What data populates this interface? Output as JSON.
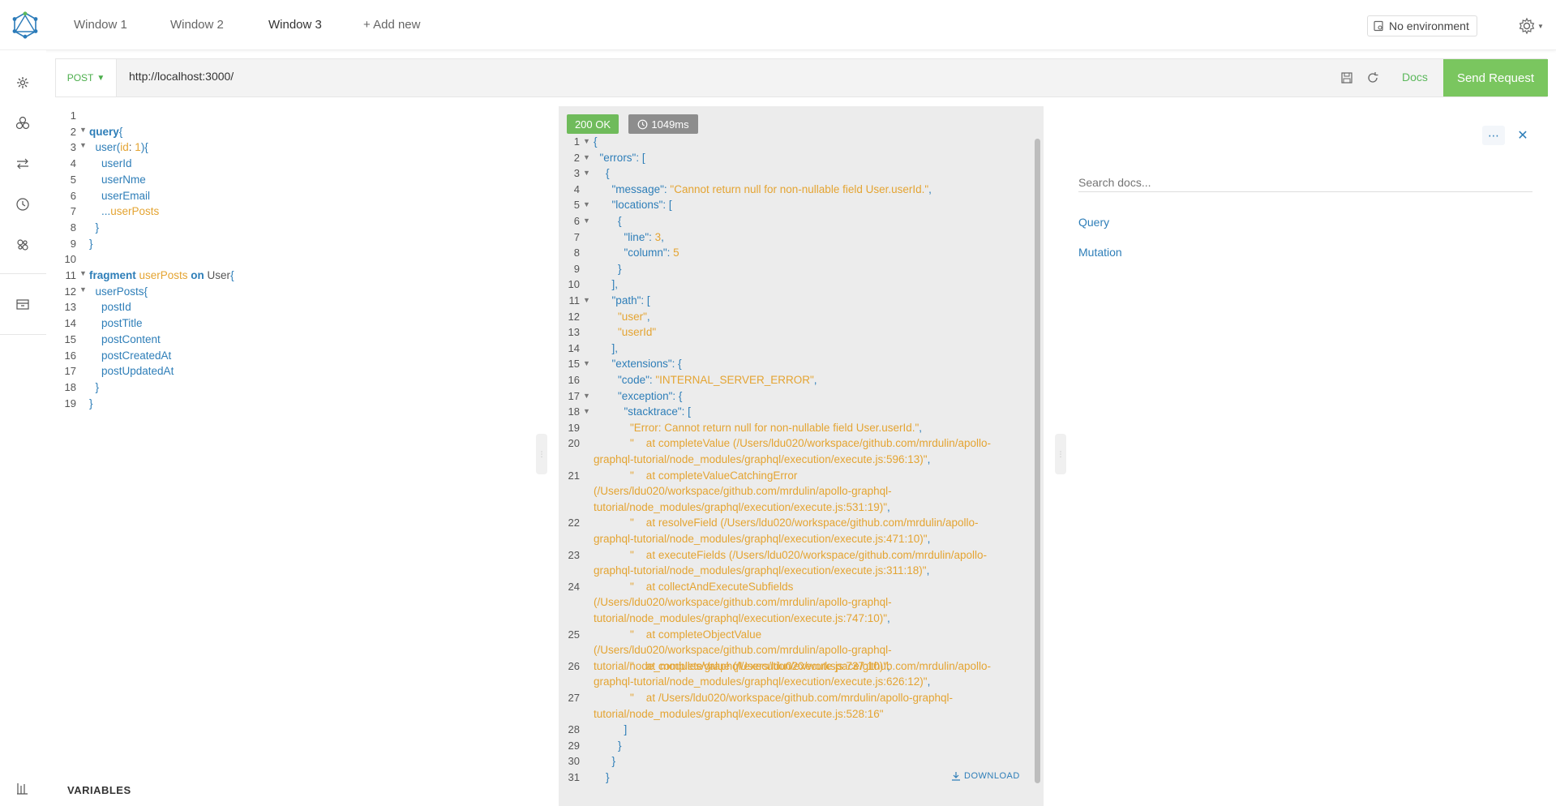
{
  "header": {
    "tabs": [
      {
        "label": "Window 1",
        "active": false
      },
      {
        "label": "Window 2",
        "active": false
      },
      {
        "label": "Window 3",
        "active": true
      }
    ],
    "add_new": "+ Add new",
    "environment": "No environment",
    "environment_icon": "environment-icon",
    "settings_icon": "gear-icon"
  },
  "sidebar": {
    "icons": [
      "gear-icon",
      "collections-icon",
      "swap-icon",
      "history-icon",
      "plugins-icon",
      "archive-icon",
      "stats-icon"
    ]
  },
  "request": {
    "method": "POST",
    "url": "http://localhost:3000/",
    "docs_label": "Docs",
    "send_label": "Send Request",
    "accent_color": "#7ac65f"
  },
  "editor": {
    "lines": [
      {
        "n": "1",
        "fold": false,
        "tokens": []
      },
      {
        "n": "2",
        "fold": true,
        "tokens": [
          {
            "t": "query",
            "c": "k-kw"
          },
          {
            "t": "{",
            "c": "k-punct"
          }
        ]
      },
      {
        "n": "3",
        "fold": true,
        "tokens": [
          {
            "t": "  user",
            "c": "k-field"
          },
          {
            "t": "(",
            "c": "k-punct"
          },
          {
            "t": "id",
            "c": "k-frag"
          },
          {
            "t": ": ",
            "c": "k-type"
          },
          {
            "t": "1",
            "c": "k-num"
          },
          {
            "t": "){",
            "c": "k-punct"
          }
        ]
      },
      {
        "n": "4",
        "fold": false,
        "tokens": [
          {
            "t": "    userId",
            "c": "k-field"
          }
        ]
      },
      {
        "n": "5",
        "fold": false,
        "tokens": [
          {
            "t": "    userNme",
            "c": "k-field"
          }
        ]
      },
      {
        "n": "6",
        "fold": false,
        "tokens": [
          {
            "t": "    userEmail",
            "c": "k-field"
          }
        ]
      },
      {
        "n": "7",
        "fold": false,
        "tokens": [
          {
            "t": "    ...",
            "c": "k-field"
          },
          {
            "t": "userPosts",
            "c": "k-frag"
          }
        ]
      },
      {
        "n": "8",
        "fold": false,
        "tokens": [
          {
            "t": "  }",
            "c": "k-punct"
          }
        ]
      },
      {
        "n": "9",
        "fold": false,
        "tokens": [
          {
            "t": "}",
            "c": "k-punct"
          }
        ]
      },
      {
        "n": "10",
        "fold": false,
        "tokens": []
      },
      {
        "n": "11",
        "fold": true,
        "tokens": [
          {
            "t": "fragment ",
            "c": "k-kw"
          },
          {
            "t": "userPosts ",
            "c": "k-frag"
          },
          {
            "t": "on ",
            "c": "k-kw"
          },
          {
            "t": "User",
            "c": "k-type"
          },
          {
            "t": "{",
            "c": "k-punct"
          }
        ]
      },
      {
        "n": "12",
        "fold": true,
        "tokens": [
          {
            "t": "  userPosts",
            "c": "k-field"
          },
          {
            "t": "{",
            "c": "k-punct"
          }
        ]
      },
      {
        "n": "13",
        "fold": false,
        "tokens": [
          {
            "t": "    postId",
            "c": "k-field"
          }
        ]
      },
      {
        "n": "14",
        "fold": false,
        "tokens": [
          {
            "t": "    postTitle",
            "c": "k-field"
          }
        ]
      },
      {
        "n": "15",
        "fold": false,
        "tokens": [
          {
            "t": "    postContent",
            "c": "k-field"
          }
        ]
      },
      {
        "n": "16",
        "fold": false,
        "tokens": [
          {
            "t": "    postCreatedAt",
            "c": "k-field"
          }
        ]
      },
      {
        "n": "17",
        "fold": false,
        "tokens": [
          {
            "t": "    postUpdatedAt",
            "c": "k-field"
          }
        ]
      },
      {
        "n": "18",
        "fold": false,
        "tokens": [
          {
            "t": "  }",
            "c": "k-punct"
          }
        ]
      },
      {
        "n": "19",
        "fold": false,
        "tokens": [
          {
            "t": "}",
            "c": "k-punct"
          }
        ]
      }
    ],
    "variables_label": "VARIABLES"
  },
  "result": {
    "status": "200 OK",
    "time": "1049ms",
    "download_label": "DOWNLOAD",
    "lines": [
      {
        "n": "1",
        "fold": true,
        "rows": 1,
        "tokens": [
          {
            "t": "{",
            "c": "s-p"
          }
        ]
      },
      {
        "n": "2",
        "fold": true,
        "rows": 1,
        "tokens": [
          {
            "t": "  \"errors\"",
            "c": "s-key"
          },
          {
            "t": ": [",
            "c": "s-p"
          }
        ]
      },
      {
        "n": "3",
        "fold": true,
        "rows": 1,
        "tokens": [
          {
            "t": "    {",
            "c": "s-p"
          }
        ]
      },
      {
        "n": "4",
        "fold": false,
        "rows": 1,
        "tokens": [
          {
            "t": "      \"message\"",
            "c": "s-key"
          },
          {
            "t": ": ",
            "c": "s-p"
          },
          {
            "t": "\"Cannot return null for non-nullable field User.userId.\"",
            "c": "s-str"
          },
          {
            "t": ",",
            "c": "s-p"
          }
        ]
      },
      {
        "n": "5",
        "fold": true,
        "rows": 1,
        "tokens": [
          {
            "t": "      \"locations\"",
            "c": "s-key"
          },
          {
            "t": ": [",
            "c": "s-p"
          }
        ]
      },
      {
        "n": "6",
        "fold": true,
        "rows": 1,
        "tokens": [
          {
            "t": "        {",
            "c": "s-p"
          }
        ]
      },
      {
        "n": "7",
        "fold": false,
        "rows": 1,
        "tokens": [
          {
            "t": "          \"line\"",
            "c": "s-key"
          },
          {
            "t": ": ",
            "c": "s-p"
          },
          {
            "t": "3",
            "c": "s-num"
          },
          {
            "t": ",",
            "c": "s-p"
          }
        ]
      },
      {
        "n": "8",
        "fold": false,
        "rows": 1,
        "tokens": [
          {
            "t": "          \"column\"",
            "c": "s-key"
          },
          {
            "t": ": ",
            "c": "s-p"
          },
          {
            "t": "5",
            "c": "s-num"
          }
        ]
      },
      {
        "n": "9",
        "fold": false,
        "rows": 1,
        "tokens": [
          {
            "t": "        }",
            "c": "s-p"
          }
        ]
      },
      {
        "n": "10",
        "fold": false,
        "rows": 1,
        "tokens": [
          {
            "t": "      ],",
            "c": "s-p"
          }
        ]
      },
      {
        "n": "11",
        "fold": true,
        "rows": 1,
        "tokens": [
          {
            "t": "      \"path\"",
            "c": "s-key"
          },
          {
            "t": ": [",
            "c": "s-p"
          }
        ]
      },
      {
        "n": "12",
        "fold": false,
        "rows": 1,
        "tokens": [
          {
            "t": "        \"user\"",
            "c": "s-str"
          },
          {
            "t": ",",
            "c": "s-p"
          }
        ]
      },
      {
        "n": "13",
        "fold": false,
        "rows": 1,
        "tokens": [
          {
            "t": "        \"userId\"",
            "c": "s-str"
          }
        ]
      },
      {
        "n": "14",
        "fold": false,
        "rows": 1,
        "tokens": [
          {
            "t": "      ],",
            "c": "s-p"
          }
        ]
      },
      {
        "n": "15",
        "fold": true,
        "rows": 1,
        "tokens": [
          {
            "t": "      \"extensions\"",
            "c": "s-key"
          },
          {
            "t": ": {",
            "c": "s-p"
          }
        ]
      },
      {
        "n": "16",
        "fold": false,
        "rows": 1,
        "tokens": [
          {
            "t": "        \"code\"",
            "c": "s-key"
          },
          {
            "t": ": ",
            "c": "s-p"
          },
          {
            "t": "\"INTERNAL_SERVER_ERROR\"",
            "c": "s-str"
          },
          {
            "t": ",",
            "c": "s-p"
          }
        ]
      },
      {
        "n": "17",
        "fold": true,
        "rows": 1,
        "tokens": [
          {
            "t": "        \"exception\"",
            "c": "s-key"
          },
          {
            "t": ": {",
            "c": "s-p"
          }
        ]
      },
      {
        "n": "18",
        "fold": true,
        "rows": 1,
        "tokens": [
          {
            "t": "          \"stacktrace\"",
            "c": "s-key"
          },
          {
            "t": ": [",
            "c": "s-p"
          }
        ]
      },
      {
        "n": "19",
        "fold": false,
        "rows": 1,
        "tokens": [
          {
            "t": "            \"Error: Cannot return null for non-nullable field User.userId.\"",
            "c": "s-str"
          },
          {
            "t": ",",
            "c": "s-p"
          }
        ]
      },
      {
        "n": "20",
        "fold": false,
        "rows": 2,
        "tokens": [
          {
            "t": "            \"    at completeValue (/Users/ldu020/workspace/github.com/mrdulin/apollo-graphql-tutorial/node_modules/graphql/execution/execute.js:596:13)\"",
            "c": "s-str"
          },
          {
            "t": ",",
            "c": "s-p"
          }
        ]
      },
      {
        "n": "21",
        "fold": false,
        "rows": 3,
        "tokens": [
          {
            "t": "            \"    at completeValueCatchingError (/Users/ldu020/workspace/github.com/mrdulin/apollo-graphql-tutorial/node_modules/graphql/execution/execute.js:531:19)\"",
            "c": "s-str"
          },
          {
            "t": ",",
            "c": "s-p"
          }
        ]
      },
      {
        "n": "22",
        "fold": false,
        "rows": 2,
        "tokens": [
          {
            "t": "            \"    at resolveField (/Users/ldu020/workspace/github.com/mrdulin/apollo-graphql-tutorial/node_modules/graphql/execution/execute.js:471:10)\"",
            "c": "s-str"
          },
          {
            "t": ",",
            "c": "s-p"
          }
        ]
      },
      {
        "n": "23",
        "fold": false,
        "rows": 2,
        "tokens": [
          {
            "t": "            \"    at executeFields (/Users/ldu020/workspace/github.com/mrdulin/apollo-graphql-tutorial/node_modules/graphql/execution/execute.js:311:18)\"",
            "c": "s-str"
          },
          {
            "t": ",",
            "c": "s-p"
          }
        ]
      },
      {
        "n": "24",
        "fold": false,
        "rows": 3,
        "tokens": [
          {
            "t": "            \"    at collectAndExecuteSubfields (/Users/ldu020/workspace/github.com/mrdulin/apollo-graphql-tutorial/node_modules/graphql/execution/execute.js:747:10)\"",
            "c": "s-str"
          },
          {
            "t": ",",
            "c": "s-p"
          }
        ]
      },
      {
        "n": "25",
        "fold": false,
        "rows": 2,
        "tokens": [
          {
            "t": "            \"    at completeObjectValue (/Users/ldu020/workspace/github.com/mrdulin/apollo-graphql-tutorial/node_modules/graphql/execution/execute.js:737:10)\"",
            "c": "s-str"
          },
          {
            "t": ",",
            "c": "s-p"
          }
        ]
      },
      {
        "n": "26",
        "fold": false,
        "rows": 2,
        "tokens": [
          {
            "t": "            \"    at completeValue (/Users/ldu020/workspace/github.com/mrdulin/apollo-graphql-tutorial/node_modules/graphql/execution/execute.js:626:12)\"",
            "c": "s-str"
          },
          {
            "t": ",",
            "c": "s-p"
          }
        ]
      },
      {
        "n": "27",
        "fold": false,
        "rows": 2,
        "tokens": [
          {
            "t": "            \"    at /Users/ldu020/workspace/github.com/mrdulin/apollo-graphql-tutorial/node_modules/graphql/execution/execute.js:528:16\"",
            "c": "s-str"
          }
        ]
      },
      {
        "n": "28",
        "fold": false,
        "rows": 1,
        "tokens": [
          {
            "t": "          ]",
            "c": "s-p"
          }
        ]
      },
      {
        "n": "29",
        "fold": false,
        "rows": 1,
        "tokens": [
          {
            "t": "        }",
            "c": "s-p"
          }
        ]
      },
      {
        "n": "30",
        "fold": false,
        "rows": 1,
        "tokens": [
          {
            "t": "      }",
            "c": "s-p"
          }
        ]
      },
      {
        "n": "31",
        "fold": false,
        "rows": 1,
        "tokens": [
          {
            "t": "    }",
            "c": "s-p"
          }
        ]
      }
    ]
  },
  "docs": {
    "search_placeholder": "Search docs...",
    "links": [
      "Query",
      "Mutation"
    ]
  }
}
